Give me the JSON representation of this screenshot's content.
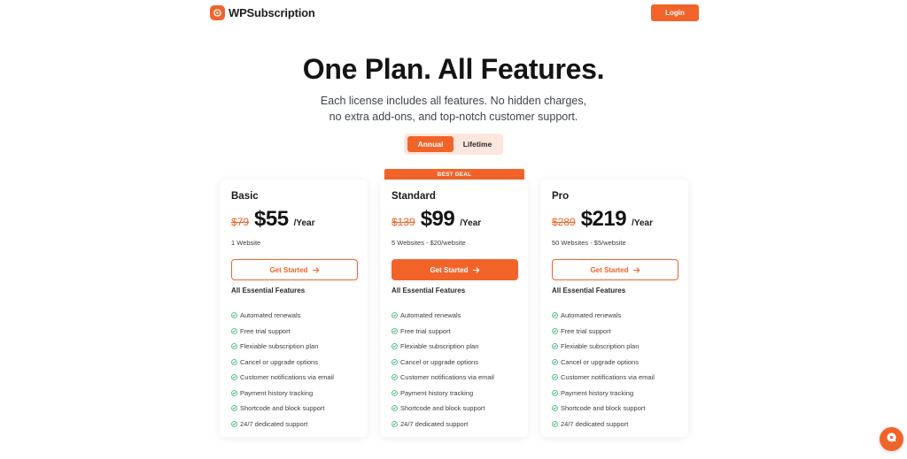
{
  "brand": {
    "name": "WPSubscription",
    "logo_icon": "wpsubscription-logo-icon",
    "accent": "#f2632a"
  },
  "header": {
    "login_label": "Login"
  },
  "hero": {
    "title": "One Plan. All Features.",
    "subtitle_line1": "Each license includes all features. No hidden charges,",
    "subtitle_line2": "no extra add-ons, and top-notch customer support."
  },
  "billing_toggle": {
    "options": [
      "Annual",
      "Lifetime"
    ],
    "selected": "Annual"
  },
  "ribbon": {
    "label": "BEST DEAL"
  },
  "plans": [
    {
      "name": "Basic",
      "old_price": "$79",
      "price": "$55",
      "period": "/Year",
      "websites": "1 Website",
      "cta_label": "Get Started",
      "cta_style": "outline",
      "features_heading": "All Essential Features",
      "features": [
        "Automated renewals",
        "Free trial support",
        "Flexiable subscription plan",
        "Cancel or upgrade options",
        "Customer notifications via email",
        "Payment history tracking",
        "Shortcode and block support",
        "24/7 dedicated support"
      ]
    },
    {
      "name": "Standard",
      "old_price": "$139",
      "price": "$99",
      "period": "/Year",
      "websites": "5 Websites - $20/website",
      "cta_label": "Get Started",
      "cta_style": "filled",
      "features_heading": "All Essential Features",
      "features": [
        "Automated renewals",
        "Free trial support",
        "Flexiable subscription plan",
        "Cancel or upgrade options",
        "Customer notifications via email",
        "Payment history tracking",
        "Shortcode and block support",
        "24/7 dedicated support"
      ]
    },
    {
      "name": "Pro",
      "old_price": "$289",
      "price": "$219",
      "period": "/Year",
      "websites": "50 Websites - $5/website",
      "cta_label": "Get Started",
      "cta_style": "outline",
      "features_heading": "All Essential Features",
      "features": [
        "Automated renewals",
        "Free trial support",
        "Flexiable subscription plan",
        "Cancel or upgrade options",
        "Customer notifications via email",
        "Payment history tracking",
        "Shortcode and block support",
        "24/7 dedicated support"
      ]
    }
  ],
  "chat_widget": {
    "icon": "chat-bubble-icon"
  }
}
